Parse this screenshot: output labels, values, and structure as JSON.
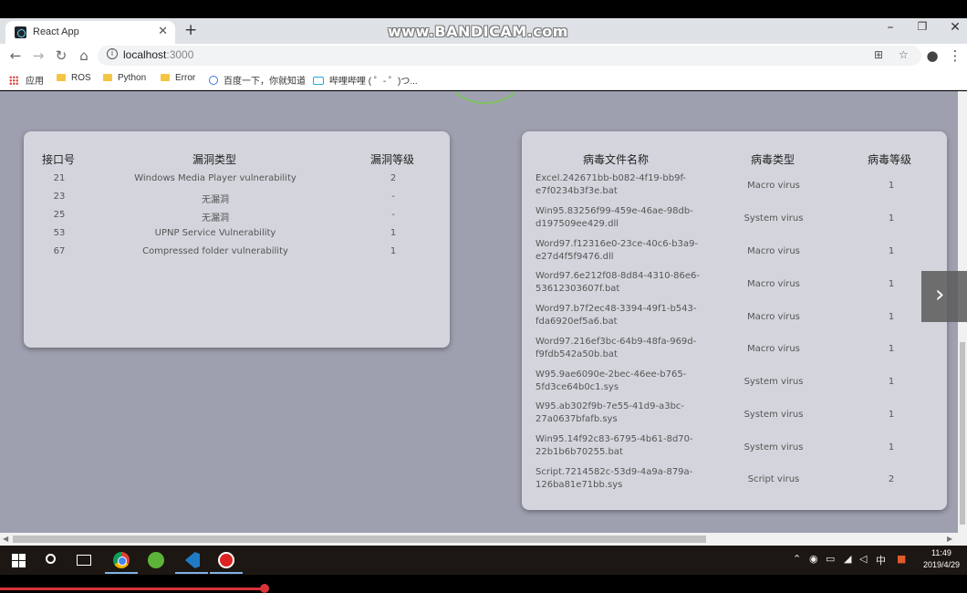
{
  "browser": {
    "tab_title": "React App",
    "url_host": "localhost",
    "url_port": ":3000",
    "watermark": "www.BANDICAM.com"
  },
  "bookmarks": [
    "应用",
    "ROS",
    "Python",
    "Error",
    "百度一下，你就知道",
    "哔哩哔哩 ( ゜- ゜)つ..."
  ],
  "ports_table": {
    "headers": [
      "接口号",
      "漏洞类型",
      "漏洞等级"
    ],
    "rows": [
      [
        "21",
        "Windows Media Player vulnerability",
        "2"
      ],
      [
        "23",
        "无漏洞",
        "-"
      ],
      [
        "25",
        "无漏洞",
        "-"
      ],
      [
        "53",
        "UPNP Service Vulnerability",
        "1"
      ],
      [
        "67",
        "Compressed folder vulnerability",
        "1"
      ]
    ]
  },
  "virus_table": {
    "headers": [
      "病毒文件名称",
      "病毒类型",
      "病毒等级"
    ],
    "rows": [
      [
        "Excel.242671bb-b082-4f19-bb9f-e7f0234b3f3e.bat",
        "Macro virus",
        "1"
      ],
      [
        "Win95.83256f99-459e-46ae-98db-d197509ee429.dll",
        "System virus",
        "1"
      ],
      [
        "Word97.f12316e0-23ce-40c6-b3a9-e27d4f5f9476.dll",
        "Macro virus",
        "1"
      ],
      [
        "Word97.6e212f08-8d84-4310-86e6-53612303607f.bat",
        "Macro virus",
        "1"
      ],
      [
        "Word97.b7f2ec48-3394-49f1-b543-fda6920ef5a6.bat",
        "Macro virus",
        "1"
      ],
      [
        "Word97.216ef3bc-64b9-48fa-969d-f9fdb542a50b.bat",
        "Macro virus",
        "1"
      ],
      [
        "W95.9ae6090e-2bec-46ee-b765-5fd3ce64b0c1.sys",
        "System virus",
        "1"
      ],
      [
        "W95.ab302f9b-7e55-41d9-a3bc-27a0637bfafb.sys",
        "System virus",
        "1"
      ],
      [
        "Win95.14f92c83-6795-4b61-8d70-22b1b6b70255.bat",
        "System virus",
        "1"
      ],
      [
        "Script.7214582c-53d9-4a9a-879a-126ba81e71bb.sys",
        "Script virus",
        "2"
      ]
    ]
  },
  "taskbar": {
    "clock_time": "11:49",
    "clock_date": "2019/4/29",
    "ime": "中"
  }
}
